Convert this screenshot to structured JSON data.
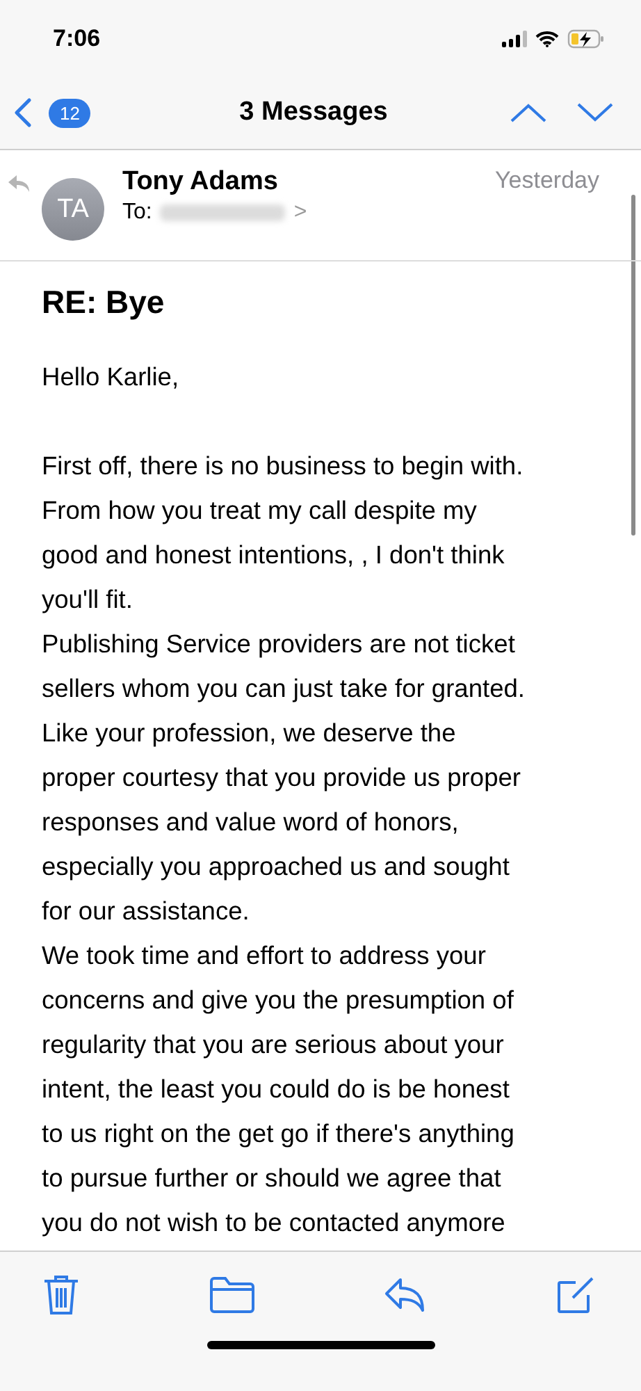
{
  "status_bar": {
    "time": "7:06"
  },
  "nav_bar": {
    "back_count": "12",
    "title": "3 Messages"
  },
  "message": {
    "sender_initials": "TA",
    "sender": "Tony Adams",
    "to_label": "To:",
    "recipient_chevron": ">",
    "date": "Yesterday",
    "subject": "RE: Bye",
    "paragraphs": [
      {
        "lines": [
          "Hello Karlie,"
        ]
      },
      {
        "lines": [
          "First off, there is no business to begin with.",
          "From how you treat my call despite my",
          "good and honest intentions, , I don't think",
          "you'll fit."
        ]
      },
      {
        "lines": [
          "Publishing Service providers are not ticket",
          "sellers whom you can just take for granted.",
          "Like your profession, we deserve the",
          "proper courtesy that you provide us proper",
          "responses and value word of honors,",
          "especially you approached us and sought",
          "for our assistance."
        ]
      },
      {
        "lines": [
          "We took time and effort to address your",
          "concerns and give you the presumption of",
          "regularity that you are serious about your",
          "intent, the least you could do is be honest",
          "to us right on the get go if there's anything",
          "to pursue further or should we agree that",
          "you do not wish to be contacted anymore"
        ]
      }
    ]
  }
}
